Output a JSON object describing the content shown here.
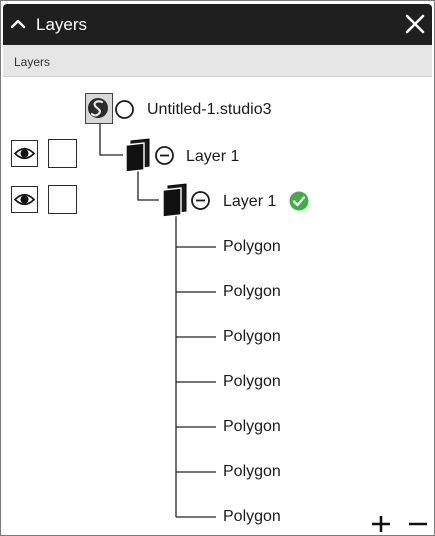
{
  "window": {
    "title": "Layers"
  },
  "subheader": {
    "label": "Layers"
  },
  "tree": {
    "document": {
      "label": "Untitled-1.studio3"
    },
    "layers": [
      {
        "label": "Layer 1"
      },
      {
        "label": "Layer 1",
        "status": "ok"
      }
    ],
    "children": [
      "Polygon",
      "Polygon",
      "Polygon",
      "Polygon",
      "Polygon",
      "Polygon",
      "Polygon"
    ]
  },
  "icons": {
    "collapse": "chevron-up-icon",
    "close": "close-icon",
    "document": "studio-document-icon",
    "layer": "layer-stack-icon",
    "visibility": "eye-icon",
    "add": "plus-icon",
    "remove": "minus-icon"
  },
  "colors": {
    "titlebar": "#1f1f1f",
    "subheader": "#e6e6e6",
    "ok": "#3cb043"
  }
}
